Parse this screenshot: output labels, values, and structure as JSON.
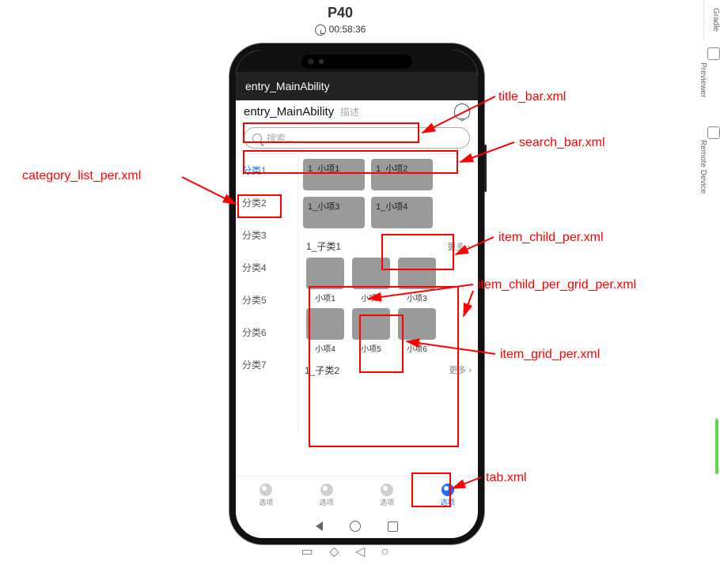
{
  "device_label": "P40",
  "timer": "00:58:36",
  "phone": {
    "titlebar": "entry_MainAbility",
    "header2_title": "entry_MainAbility",
    "header2_sub": "描述",
    "search_placeholder": "搜索...",
    "categories": [
      "分类1",
      "分类2",
      "分类3",
      "分类4",
      "分类5",
      "分类6",
      "分类7"
    ],
    "top_tiles": [
      "1_小项1",
      "1_小项2",
      "1_小项3",
      "1_小项4"
    ],
    "section1_title": "1_子类1",
    "more_label": "更多",
    "grid_row1": [
      "小项1",
      "小项2",
      "小项3"
    ],
    "grid_row2": [
      "小项4",
      "小项5",
      "小项6"
    ],
    "section2_title": "1_子类2",
    "section2_more": "更多",
    "tabs": [
      "选项",
      "选项",
      "选项",
      "选项"
    ]
  },
  "annotations": {
    "title_bar": "title_bar.xml",
    "search_bar": "search_bar.xml",
    "category_list": "category_list_per.xml",
    "item_child": "item_child_per.xml",
    "item_child_grid": "item_child_per_grid_per.xml",
    "item_grid": "item_grid_per.xml",
    "tab": "tab.xml"
  },
  "side_tabs": {
    "t1": "Gradle",
    "t2": "Previewer",
    "t3": "Remote Device"
  }
}
